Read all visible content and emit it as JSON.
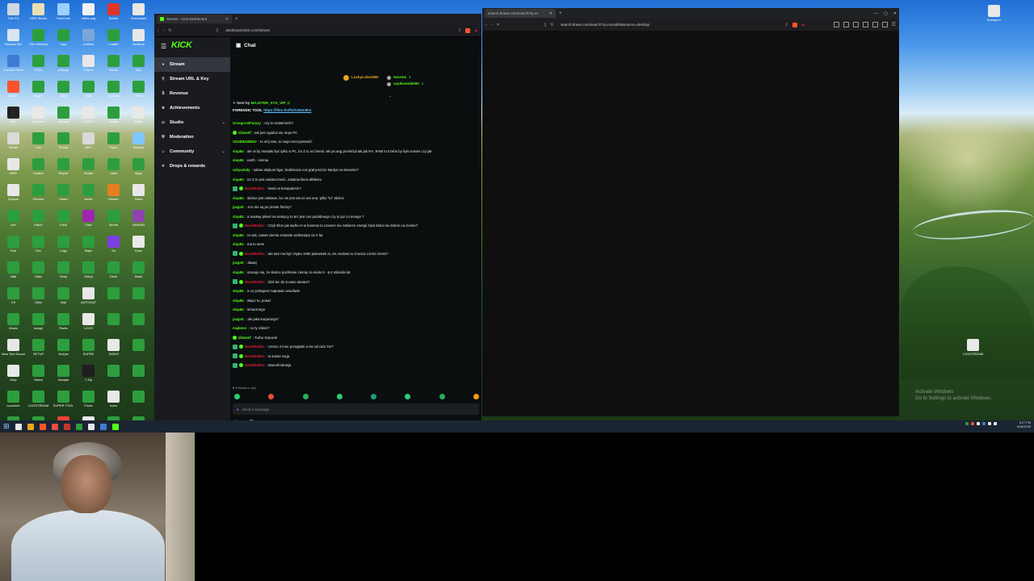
{
  "desktop": {
    "left_icons": [
      {
        "label": "This PC",
        "color": "#cfd8e0"
      },
      {
        "label": "OBS Studio",
        "color": "#e8e0b0"
      },
      {
        "label": "PostCast",
        "color": "#9bd0ff"
      },
      {
        "label": "editor.png",
        "color": "#f2f2f2"
      },
      {
        "label": "Adobe",
        "color": "#e0342a"
      },
      {
        "label": "Downloads",
        "color": "#e8e8e8"
      },
      {
        "label": "Recycle Bin",
        "color": "#d8e6f2"
      },
      {
        "label": "Gen shortcut",
        "color": "#2d9e3e"
      },
      {
        "label": "ergo",
        "color": "#2d9e3e"
      },
      {
        "label": "Untitled",
        "color": "#7aa7d6"
      },
      {
        "label": "Loader",
        "color": "#2d9e3e"
      },
      {
        "label": "Desktop",
        "color": "#e8e8e8"
      },
      {
        "label": "Control Panel",
        "color": "#3f7bd1"
      },
      {
        "label": "TOOL",
        "color": "#2d9e3e"
      },
      {
        "label": "settings",
        "color": "#2d9e3e"
      },
      {
        "label": "Thumb",
        "color": "#e8e8e8"
      },
      {
        "label": "Dump",
        "color": "#2d9e3e"
      },
      {
        "label": "SQL",
        "color": "#2d9e3e"
      },
      {
        "label": "Brave",
        "color": "#fb542b"
      },
      {
        "label": "player",
        "color": "#2d9e3e"
      },
      {
        "label": "notes",
        "color": "#2d9e3e"
      },
      {
        "label": "Tools",
        "color": "#2d9e3e"
      },
      {
        "label": "Scanner",
        "color": "#2d9e3e"
      },
      {
        "label": "Video",
        "color": "#2d9e3e"
      },
      {
        "label": "OBS",
        "color": "#232323"
      },
      {
        "label": "Camera",
        "color": "#e8e8e8"
      },
      {
        "label": "sounds",
        "color": "#2d9e3e"
      },
      {
        "label": "USER",
        "color": "#e8e8e8"
      },
      {
        "label": "Media",
        "color": "#2d9e3e"
      },
      {
        "label": "Editor",
        "color": "#e8e8e8"
      },
      {
        "label": "Steam",
        "color": "#dadada"
      },
      {
        "label": "Lab",
        "color": "#2d9e3e"
      },
      {
        "label": "Phone",
        "color": "#2d9e3e"
      },
      {
        "label": "ARC",
        "color": "#d9d9d9"
      },
      {
        "label": "Sync",
        "color": "#2d9e3e"
      },
      {
        "label": "Backup",
        "color": "#7ec7ff"
      },
      {
        "label": "MBR",
        "color": "#e8e8e8"
      },
      {
        "label": "Toolbox",
        "color": "#2d9e3e"
      },
      {
        "label": "Report",
        "color": "#2d9e3e"
      },
      {
        "label": "Studio",
        "color": "#2d9e3e"
      },
      {
        "label": "Links",
        "color": "#2d9e3e"
      },
      {
        "label": "Apps",
        "color": "#2d9e3e"
      },
      {
        "label": "System",
        "color": "#e8e8e8"
      },
      {
        "label": "Cleaner",
        "color": "#2d9e3e"
      },
      {
        "label": "Share",
        "color": "#2d9e3e"
      },
      {
        "label": "Audio",
        "color": "#2d9e3e"
      },
      {
        "label": "Sender",
        "color": "#e67e22"
      },
      {
        "label": "Tasks",
        "color": "#e8e8e8"
      },
      {
        "label": "Net",
        "color": "#2d9e3e"
      },
      {
        "label": "Patch",
        "color": "#2d9e3e"
      },
      {
        "label": "Pack",
        "color": "#2d9e3e"
      },
      {
        "label": "Files",
        "color": "#9c27b0"
      },
      {
        "label": "Server",
        "color": "#2d9e3e"
      },
      {
        "label": "WinRAR",
        "color": "#8e44ad"
      },
      {
        "label": "Run",
        "color": "#2d9e3e"
      },
      {
        "label": "Dev",
        "color": "#2d9e3e"
      },
      {
        "label": "Logs",
        "color": "#2d9e3e"
      },
      {
        "label": "Maps",
        "color": "#2d9e3e"
      },
      {
        "label": "Tor",
        "color": "#7d3fe0"
      },
      {
        "label": "Docs",
        "color": "#e8e8e8"
      },
      {
        "label": "Utils",
        "color": "#2d9e3e"
      },
      {
        "label": "Sites",
        "color": "#2d9e3e"
      },
      {
        "label": "Temp",
        "color": "#2d9e3e"
      },
      {
        "label": "Setup",
        "color": "#2d9e3e"
      },
      {
        "label": "Drive",
        "color": "#2d9e3e"
      },
      {
        "label": "Mods",
        "color": "#2d9e3e"
      },
      {
        "label": "Kit",
        "color": "#2d9e3e"
      },
      {
        "label": "Data",
        "color": "#2d9e3e"
      },
      {
        "label": "Disk",
        "color": "#2d9e3e"
      },
      {
        "label": "AUTOGAT",
        "color": "#e8e8e8"
      },
      {
        "label": "",
        "color": "#2d9e3e"
      },
      {
        "label": "",
        "color": "#2d9e3e"
      },
      {
        "label": "Music",
        "color": "#2d9e3e"
      },
      {
        "label": "Image",
        "color": "#2d9e3e"
      },
      {
        "label": "Radio",
        "color": "#2d9e3e"
      },
      {
        "label": "LOGS",
        "color": "#e8e8e8"
      },
      {
        "label": "",
        "color": "#2d9e3e"
      },
      {
        "label": "",
        "color": "#2d9e3e"
      },
      {
        "label": "New Text Document",
        "color": "#e8e8e8"
      },
      {
        "label": "SETUP",
        "color": "#2d9e3e"
      },
      {
        "label": "Scripts",
        "color": "#2d9e3e"
      },
      {
        "label": "SUPER",
        "color": "#2d9e3e"
      },
      {
        "label": "TASKS",
        "color": "#e8e8e8"
      },
      {
        "label": "",
        "color": "#2d9e3e"
      },
      {
        "label": "Help",
        "color": "#e8e8e8"
      },
      {
        "label": "Notes",
        "color": "#2d9e3e"
      },
      {
        "label": "Sample",
        "color": "#2d9e3e"
      },
      {
        "label": "7-Zip",
        "color": "#1f1f1f"
      },
      {
        "label": "",
        "color": "#2d9e3e"
      },
      {
        "label": "",
        "color": "#2d9e3e"
      },
      {
        "label": "Launcher",
        "color": "#2d9e3e"
      },
      {
        "label": "LOGSTREAM",
        "color": "#2d9e3e"
      },
      {
        "label": "SUPER TOOL",
        "color": "#2d9e3e"
      },
      {
        "label": "Fonts",
        "color": "#2d9e3e"
      },
      {
        "label": "Icons",
        "color": "#e8e8e8"
      },
      {
        "label": "",
        "color": "#2d9e3e"
      },
      {
        "label": "Old",
        "color": "#2d9e3e"
      },
      {
        "label": "Archive",
        "color": "#2d9e3e"
      },
      {
        "label": "Chrome",
        "color": "#ea4335"
      },
      {
        "label": "Media",
        "color": "#e8e8e8"
      },
      {
        "label": "Extra",
        "color": "#2d9e3e"
      },
      {
        "label": "",
        "color": "#2d9e3e"
      }
    ],
    "right_icons": [
      {
        "label": "Kolegium",
        "color": "#e8e8e8"
      },
      {
        "label": "LOGSTREAM",
        "color": "#e8e8e8"
      }
    ],
    "activate_line1": "Activate Windows",
    "activate_line2": "Go to Settings to activate Windows."
  },
  "kick_window": {
    "tab_title": "Stream - Kick Dashboard",
    "url": "dashboard.kick.com/stream",
    "logo": "KICK",
    "nav": [
      {
        "label": "Stream",
        "icon": "●",
        "active": true,
        "chevron": ""
      },
      {
        "label": "Stream URL & Key",
        "icon": "⚲",
        "active": false,
        "chevron": ""
      },
      {
        "label": "Revenue",
        "icon": "$",
        "active": false,
        "chevron": ""
      },
      {
        "label": "Achievements",
        "icon": "★",
        "active": false,
        "chevron": ""
      },
      {
        "label": "Studio",
        "icon": "▭",
        "active": false,
        "chevron": "⌄"
      },
      {
        "label": "Moderation",
        "icon": "⛨",
        "active": false,
        "chevron": ""
      },
      {
        "label": "Community",
        "icon": "☺",
        "active": false,
        "chevron": "⌄"
      },
      {
        "label": "Drops & rewards",
        "icon": "✦",
        "active": false,
        "chevron": ""
      }
    ],
    "chat_title": "Chat",
    "leaderboard": [
      {
        "name": "LuckyLuke1980",
        "value": "",
        "badge": "gold"
      },
      {
        "name": "tworms",
        "value": "1",
        "badge": "dot"
      },
      {
        "name": "uzytkownik090",
        "value": "1",
        "badge": "dot"
      }
    ],
    "pinned": {
      "sent_by": "Sent by",
      "sender": "MAJSTER_SYS_VIP_C",
      "text": "FORENSIC TOOL",
      "link": "https://files.fm/f/afs284c8hn"
    },
    "messages": [
      {
        "user": "GrzegorzZFaryzy",
        "color": "#53fc18",
        "badges": "",
        "text": ": czy to malarnisch?"
      },
      {
        "user": "zibiwolf",
        "color": "#53fc18",
        "badges": "2",
        "text": ": tak jest zgadza się moje PC"
      },
      {
        "user": "SZUBIDUBIDU",
        "color": "#53fc18",
        "badges": "",
        "text": ": to mój ram, to moja rzeczywistość"
      },
      {
        "user": "slup84",
        "color": "#53fc18",
        "badges": "",
        "text": ": ale ot by musiało być tylko w PL, bo Z to od ziemii, ale po ang przełożył tak jak RA, RAM to trzeba by było earam czy jak"
      },
      {
        "user": "slup84",
        "color": "#53fc18",
        "badges": "",
        "text": ": earth - ziemia"
      },
      {
        "user": "szkywindy",
        "color": "#53fc18",
        "badges": "",
        "text": ": salam alejkum ligor, bedzieszw cos grał jeszcze kiedys na streamie?"
      },
      {
        "user": "slup84",
        "color": "#53fc18",
        "badges": "",
        "text": ": no Z to jest ostateczność, ostatnia litera alfabetu"
      },
      {
        "user": "DavidKallen",
        "color": "#e91e3c",
        "badges": "1",
        "text": ": lustro w komputerze?"
      },
      {
        "user": "slup84",
        "color": "#53fc18",
        "badges": "",
        "text": ": słońce jest ciekawe, bo nie jest ani on ani ona, tylko \"to\" słońce"
      },
      {
        "user": "jazgotr",
        "color": "#53fc18",
        "badges": "",
        "text": ": a to nie są po prostu fotony?"
      },
      {
        "user": "slup84",
        "color": "#53fc18",
        "badges": "",
        "text": ": a martwy piksel na matrycy to też jest cos podobnego czy to juz co innego ?"
      },
      {
        "user": "DavidKallen",
        "color": "#e91e3c",
        "badges": "1",
        "text": ": Czyli Elon jak wyśle AI w kosmos to czasem nie zabierze energii Ojca która nie dotrze na ziemie?"
      },
      {
        "user": "slup84",
        "color": "#53fc18",
        "badges": "",
        "text": ": no tak, nawet ziemia zostanie wchłonięta za X lat"
      },
      {
        "user": "slup84",
        "color": "#53fc18",
        "badges": "",
        "text": ": ma to sens"
      },
      {
        "user": "DavidKallen",
        "color": "#e91e3c",
        "badges": "1",
        "text": ": ale tam ma być chyba 1000 jednostek ai, nie zaolowi to chociaz cześci ziemii?"
      },
      {
        "user": "jazgotr",
        "color": "#53fc18",
        "badges": "",
        "text": ": dawaj"
      },
      {
        "user": "slup84",
        "color": "#53fc18",
        "badges": "",
        "text": ": szacuje się, że słońce pochłonie ziemię za około 5 - 5,4 miliarda lat"
      },
      {
        "user": "DavidKallen",
        "color": "#e91e3c",
        "badges": "1",
        "text": ": dziś lec do 8 nano stream?"
      },
      {
        "user": "slup84",
        "color": "#53fc18",
        "badges": "",
        "text": ": a co probujesz naprawic wracilwie"
      },
      {
        "user": "slup84",
        "color": "#53fc18",
        "badges": "",
        "text": ": włącz to, pokaż"
      },
      {
        "user": "slup84",
        "color": "#53fc18",
        "badges": "",
        "text": ": smacznego"
      },
      {
        "user": "jazgotr",
        "color": "#53fc18",
        "badges": "",
        "text": ": ale jaka korporacja?"
      },
      {
        "user": "majkeso",
        "color": "#53fc18",
        "badges": "",
        "text": ": co ty robisz?"
      },
      {
        "user": "zibiwolf",
        "color": "#53fc18",
        "badges": "2",
        "text": ": Turbo Sziporal"
      },
      {
        "user": "DavidKallen",
        "color": "#e91e3c",
        "badges": "1",
        "text": ": czemu 2 inne przeglarki a nie od razu Tor?"
      },
      {
        "user": "DavidKallen",
        "color": "#e91e3c",
        "badges": "1",
        "text": ": w sumie racja"
      },
      {
        "user": "DavidKallen",
        "color": "#e91e3c",
        "badges": "1",
        "text": ": Monolit istnieje"
      }
    ],
    "followers_only": "Followers only",
    "emotes": [
      "#2ecc71",
      "#e74c3c",
      "#27ae60",
      "#2ecc71",
      "#16a085",
      "#2ecc71",
      "#27ae60",
      "#f39c12"
    ],
    "input_placeholder": "Send a message",
    "footer_left": "00",
    "footer_right": "0"
  },
  "brave_window": {
    "tab_title": "search.brave.com/search?q=m",
    "url": "search.brave.com/search?q=monolith&source=desktop"
  },
  "taskbar": {
    "start": "⊞",
    "apps": [
      "#e8e8e8",
      "#e8a81c",
      "#fb542b",
      "#e74c3c",
      "#c0392b",
      "#2d9e3e",
      "#e8e8e8",
      "#3f7bd1",
      "#53fc18"
    ],
    "tray": [
      "#2d9e3e",
      "#e74c3c",
      "#e8e8e8",
      "#3f7bd1",
      "#e8e8e8",
      "#e8e8e8"
    ],
    "time": "6:27 PM",
    "date": "6/28/2026"
  }
}
